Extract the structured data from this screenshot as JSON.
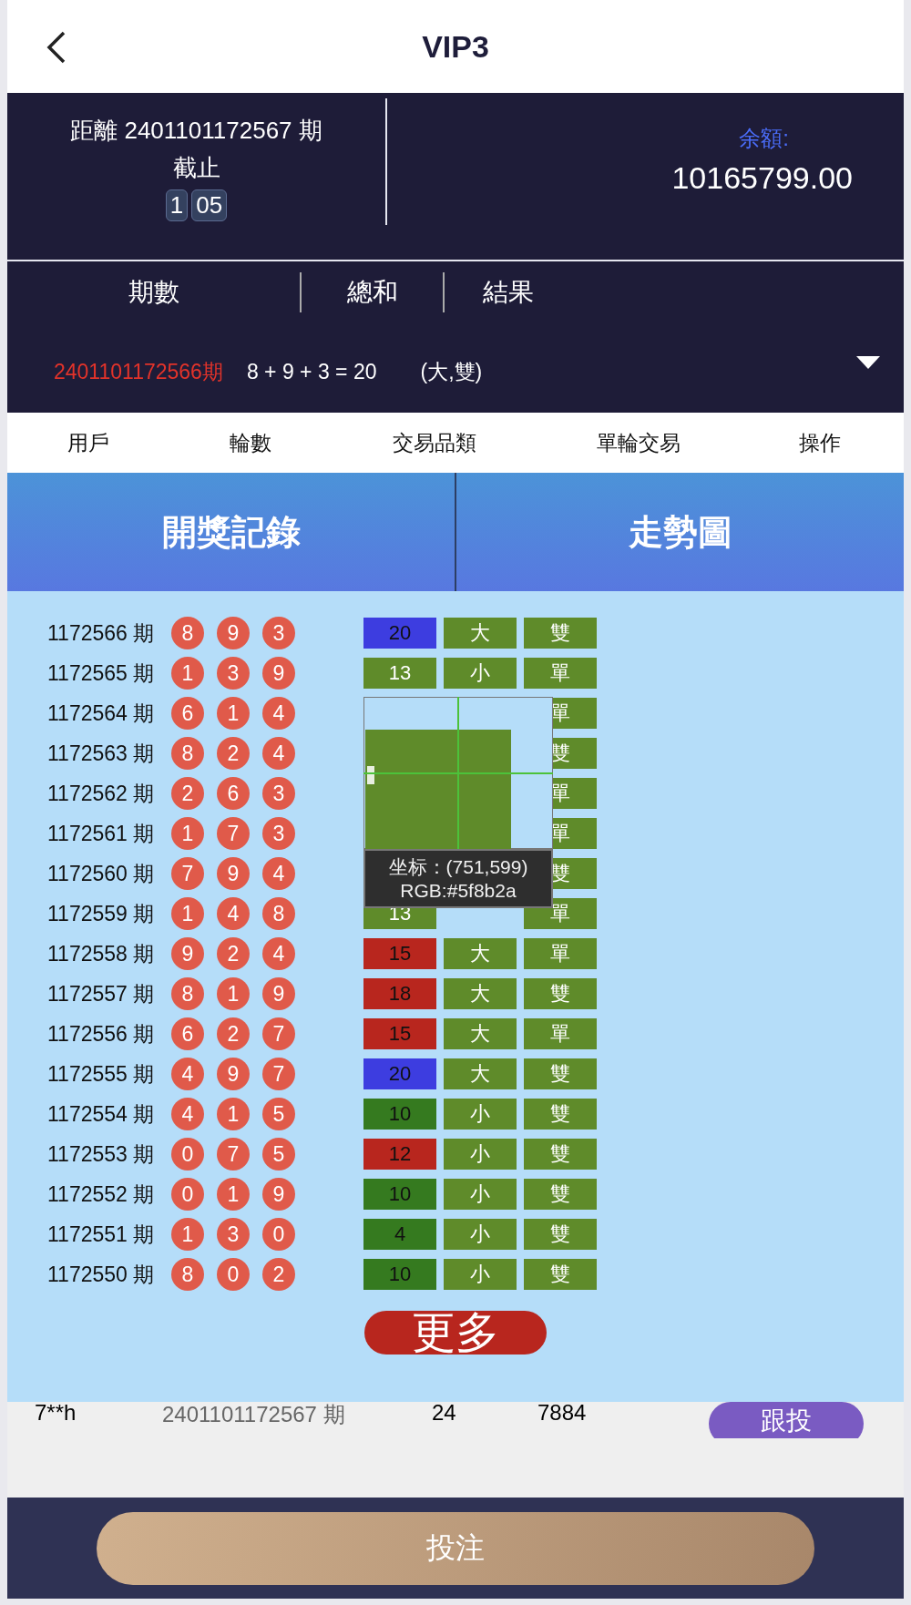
{
  "header": {
    "title": "VIP3"
  },
  "countdown": {
    "label": "距離 2401101172567 期",
    "sublabel": "截止",
    "minutes": "1",
    "seconds": "05"
  },
  "balance": {
    "label": "余額:",
    "value": "10165799.00"
  },
  "latest": {
    "columns": [
      "期數",
      "總和",
      "結果"
    ],
    "period": "2401101172566期",
    "formula": "8 + 9 + 3 = 20",
    "result": "(大,雙)"
  },
  "bet_columns": [
    "用戶",
    "輪數",
    "交易品類",
    "單輪交易",
    "操作"
  ],
  "tabs": [
    {
      "label": "開獎記錄"
    },
    {
      "label": "走勢圖"
    }
  ],
  "records": [
    {
      "period": "1172566 期",
      "balls": [
        "8",
        "9",
        "3"
      ],
      "sum": "20",
      "color": "#3d3de0",
      "size": "大",
      "parity": "雙"
    },
    {
      "period": "1172565 期",
      "balls": [
        "1",
        "3",
        "9"
      ],
      "sum": "13",
      "color": "#5f8b2a",
      "size": "小",
      "parity": "單"
    },
    {
      "period": "1172564 期",
      "balls": [
        "6",
        "1",
        "4"
      ],
      "parity": "單"
    },
    {
      "period": "1172563 期",
      "balls": [
        "8",
        "2",
        "4"
      ],
      "parity": "雙"
    },
    {
      "period": "1172562 期",
      "balls": [
        "2",
        "6",
        "3"
      ],
      "parity": "單"
    },
    {
      "period": "1172561 期",
      "balls": [
        "1",
        "7",
        "3"
      ],
      "parity": "單"
    },
    {
      "period": "1172560 期",
      "balls": [
        "7",
        "9",
        "4"
      ],
      "parity": "雙"
    },
    {
      "period": "1172559 期",
      "balls": [
        "1",
        "4",
        "8"
      ],
      "sum": "13",
      "color": "#5f8b2a",
      "parity": "單"
    },
    {
      "period": "1172558 期",
      "balls": [
        "9",
        "2",
        "4"
      ],
      "sum": "15",
      "color": "#b8261e",
      "size": "大",
      "parity": "單"
    },
    {
      "period": "1172557 期",
      "balls": [
        "8",
        "1",
        "9"
      ],
      "sum": "18",
      "color": "#b8261e",
      "size": "大",
      "parity": "雙"
    },
    {
      "period": "1172556 期",
      "balls": [
        "6",
        "2",
        "7"
      ],
      "sum": "15",
      "color": "#b8261e",
      "size": "大",
      "parity": "單"
    },
    {
      "period": "1172555 期",
      "balls": [
        "4",
        "9",
        "7"
      ],
      "sum": "20",
      "color": "#3d3de0",
      "size": "大",
      "parity": "雙"
    },
    {
      "period": "1172554 期",
      "balls": [
        "4",
        "1",
        "5"
      ],
      "sum": "10",
      "color": "#357a1f",
      "size": "小",
      "parity": "雙"
    },
    {
      "period": "1172553 期",
      "balls": [
        "0",
        "7",
        "5"
      ],
      "sum": "12",
      "color": "#b8261e",
      "size": "小",
      "parity": "雙"
    },
    {
      "period": "1172552 期",
      "balls": [
        "0",
        "1",
        "9"
      ],
      "sum": "10",
      "color": "#357a1f",
      "size": "小",
      "parity": "雙"
    },
    {
      "period": "1172551 期",
      "balls": [
        "1",
        "3",
        "0"
      ],
      "sum": "4",
      "color": "#357a1f",
      "size": "小",
      "parity": "雙"
    },
    {
      "period": "1172550 期",
      "balls": [
        "8",
        "0",
        "2"
      ],
      "sum": "10",
      "color": "#357a1f",
      "size": "小",
      "parity": "雙"
    }
  ],
  "more_button": "更多",
  "bet_rows": [
    {
      "user": "7**h",
      "period": "2401101172567 期",
      "round": "24",
      "amount": "7884",
      "action": "跟投"
    }
  ],
  "color_picker": {
    "coords": "坐标：(751,599)",
    "rgb": "RGB:#5f8b2a"
  },
  "submit": "投注"
}
